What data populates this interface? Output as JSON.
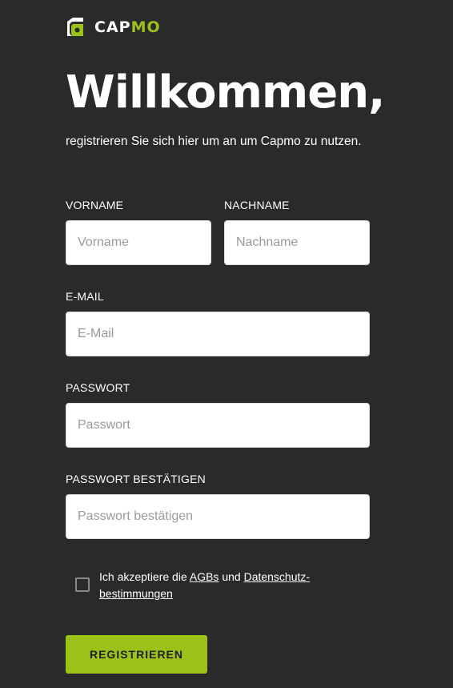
{
  "brand": {
    "logo_icon": "capmo-logo-icon",
    "name_part1": "CAP",
    "name_part2": "MO",
    "accent_color": "#9cc21a",
    "background_color": "#2a2a2a"
  },
  "header": {
    "title": "Willkommen,",
    "subtitle": "registrieren Sie sich hier um an um Capmo zu nutzen."
  },
  "form": {
    "firstname": {
      "label": "VORNAME",
      "placeholder": "Vorname",
      "value": ""
    },
    "lastname": {
      "label": "NACHNAME",
      "placeholder": "Nachname",
      "value": ""
    },
    "email": {
      "label": "E-MAIL",
      "placeholder": "E-Mail",
      "value": ""
    },
    "password": {
      "label": "PASSWORT",
      "placeholder": "Passwort",
      "value": ""
    },
    "password_confirm": {
      "label": "PASSWORT BESTÄTIGEN",
      "placeholder": "Passwort bestätigen",
      "value": ""
    },
    "consent": {
      "checked": false,
      "text_before": "Ich akzeptiere die ",
      "agb_link": "AGBs",
      "text_middle": " und ",
      "privacy_link": "Datenschutz-bestimmungen"
    },
    "submit_label": "REGISTRIEREN"
  }
}
